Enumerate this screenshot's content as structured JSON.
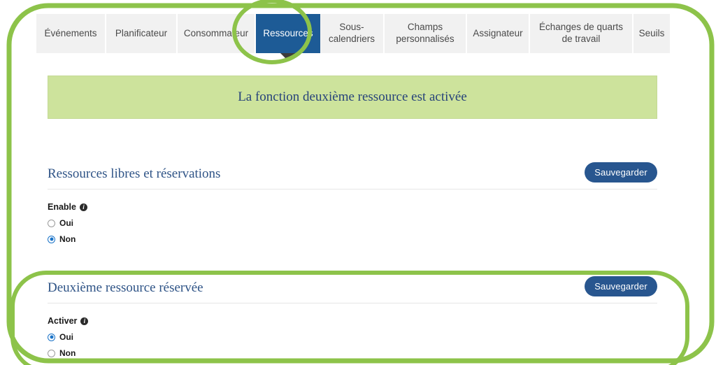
{
  "tabs": [
    {
      "label": "Événements",
      "active": false
    },
    {
      "label": "Planificateur",
      "active": false
    },
    {
      "label": "Consommateur",
      "active": false
    },
    {
      "label": "Ressources",
      "active": true
    },
    {
      "label": "Sous-calendriers",
      "active": false
    },
    {
      "label": "Champs personnalisés",
      "active": false
    },
    {
      "label": "Assignateur",
      "active": false
    },
    {
      "label": "Échanges de quarts de travail",
      "active": false
    },
    {
      "label": "Seuils",
      "active": false
    }
  ],
  "banner": {
    "message": "La fonction deuxième ressource est activée"
  },
  "sections": [
    {
      "title": "Ressources libres et réservations",
      "save_label": "Sauvegarder",
      "field_label": "Enable",
      "info_glyph": "i",
      "options": [
        {
          "label": "Oui",
          "selected": false
        },
        {
          "label": "Non",
          "selected": true
        }
      ]
    },
    {
      "title": "Deuxième ressource réservée",
      "save_label": "Sauvegarder",
      "field_label": "Activer",
      "info_glyph": "i",
      "options": [
        {
          "label": "Oui",
          "selected": true
        },
        {
          "label": "Non",
          "selected": false
        }
      ]
    }
  ],
  "annotations": {
    "highlight_color": "#8dc34a",
    "shapes": [
      {
        "name": "outer-border-highlight",
        "type": "rounded-rect"
      },
      {
        "name": "ressources-tab-highlight",
        "type": "ellipse"
      },
      {
        "name": "second-resource-section-highlight",
        "type": "rounded-rect"
      }
    ]
  },
  "colors": {
    "active_tab_bg": "#1d5b96",
    "tab_bg": "#f1f1f1",
    "banner_bg": "#cde39c",
    "banner_text": "#27437a",
    "section_title": "#2e5386",
    "save_button_bg": "#28568f",
    "radio_accent": "#1a73c8"
  }
}
